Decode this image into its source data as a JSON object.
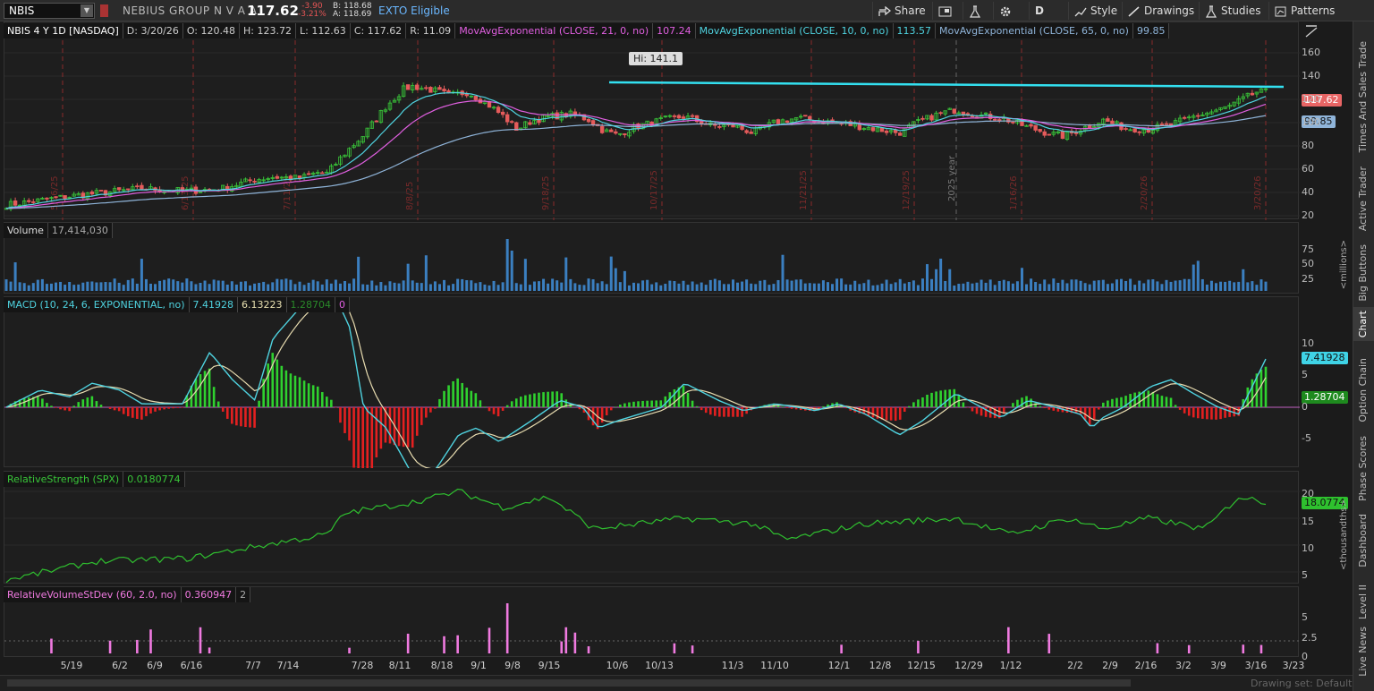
{
  "toolbar": {
    "symbol": "NBIS",
    "company": "NEBIUS GROUP N V A A",
    "last": "117.62",
    "change": "-3.90",
    "change_pct": "-3.21%",
    "bid": "B: 118.68",
    "ask": "A: 118.69",
    "exto": "EXTO Eligible",
    "share": "Share",
    "period": "D",
    "style": "Style",
    "drawings": "Drawings",
    "studies": "Studies",
    "patterns": "Patterns"
  },
  "side_tabs": [
    "Trade",
    "Times And Sales",
    "Active Trader",
    "Big Buttons",
    "Chart",
    "Option Chain",
    "Phase Scores",
    "Dashboard",
    "Level II",
    "Live News"
  ],
  "price_pane": {
    "header": [
      "NBIS 4 Y 1D [NASDAQ]",
      "D: 3/20/26",
      "O: 120.48",
      "H: 123.72",
      "L: 112.63",
      "C: 117.62",
      "R: 11.09",
      "MovAvgExponential (CLOSE, 21, 0, no)",
      "107.24",
      "MovAvgExponential (CLOSE, 10, 0, no)",
      "113.57",
      "MovAvgExponential (CLOSE, 65, 0, no)",
      "99.85"
    ],
    "axis": [
      "160",
      "140",
      "120",
      "100",
      "80",
      "60",
      "40",
      "20"
    ],
    "tag_last": "117.62",
    "tag_ema65": "99.85",
    "hi_label": "Hi: 141.1",
    "year_label": "2025 year",
    "vlines": [
      "5/16/25",
      "6/13/25",
      "7/11/25",
      "8/8/25",
      "9/18/25",
      "10/17/25",
      "11/21/25",
      "12/19/25",
      "1/16/26",
      "2/20/26",
      "3/20/26"
    ],
    "colors": {
      "candle_up": "#39c639",
      "candle_down": "#e55b5b",
      "ema10": "#4fd3e0",
      "ema21": "#e05fe0",
      "ema65": "#8fb4d9",
      "trend": "#33e0f0"
    }
  },
  "volume_pane": {
    "header": [
      "Volume",
      "17,414,030"
    ],
    "axis": [
      "75",
      "50",
      "25"
    ],
    "unit": "<millions>"
  },
  "macd_pane": {
    "header": [
      "MACD (10, 24, 6, EXPONENTIAL, no)",
      "7.41928",
      "6.13223",
      "1.28704",
      "0"
    ],
    "axis": [
      "10",
      "5",
      "0",
      "-5"
    ],
    "tag_value": "7.41928",
    "tag_diff": "1.28704"
  },
  "rs_pane": {
    "header": [
      "RelativeStrength (SPX)",
      "0.0180774"
    ],
    "axis": [
      "20",
      "15",
      "10",
      "5"
    ],
    "tag": "18.0774",
    "unit": "<thousandths>"
  },
  "rvol_pane": {
    "header": [
      "RelativeVolumeStDev (60, 2.0, no)",
      "0.360947",
      "2"
    ],
    "axis": [
      "5",
      "2.5",
      "0"
    ]
  },
  "xaxis": [
    "5/19",
    "6/2",
    "6/9",
    "6/16",
    "7/7",
    "7/14",
    "7/28",
    "8/11",
    "8/18",
    "9/1",
    "9/8",
    "9/15",
    "10/6",
    "10/13",
    "11/3",
    "11/10",
    "12/1",
    "12/8",
    "12/15",
    "12/29",
    "1/12",
    "2/2",
    "2/9",
    "2/16",
    "3/2",
    "3/9",
    "3/16",
    "3/23"
  ],
  "drawing_set": "Drawing set: Default"
}
